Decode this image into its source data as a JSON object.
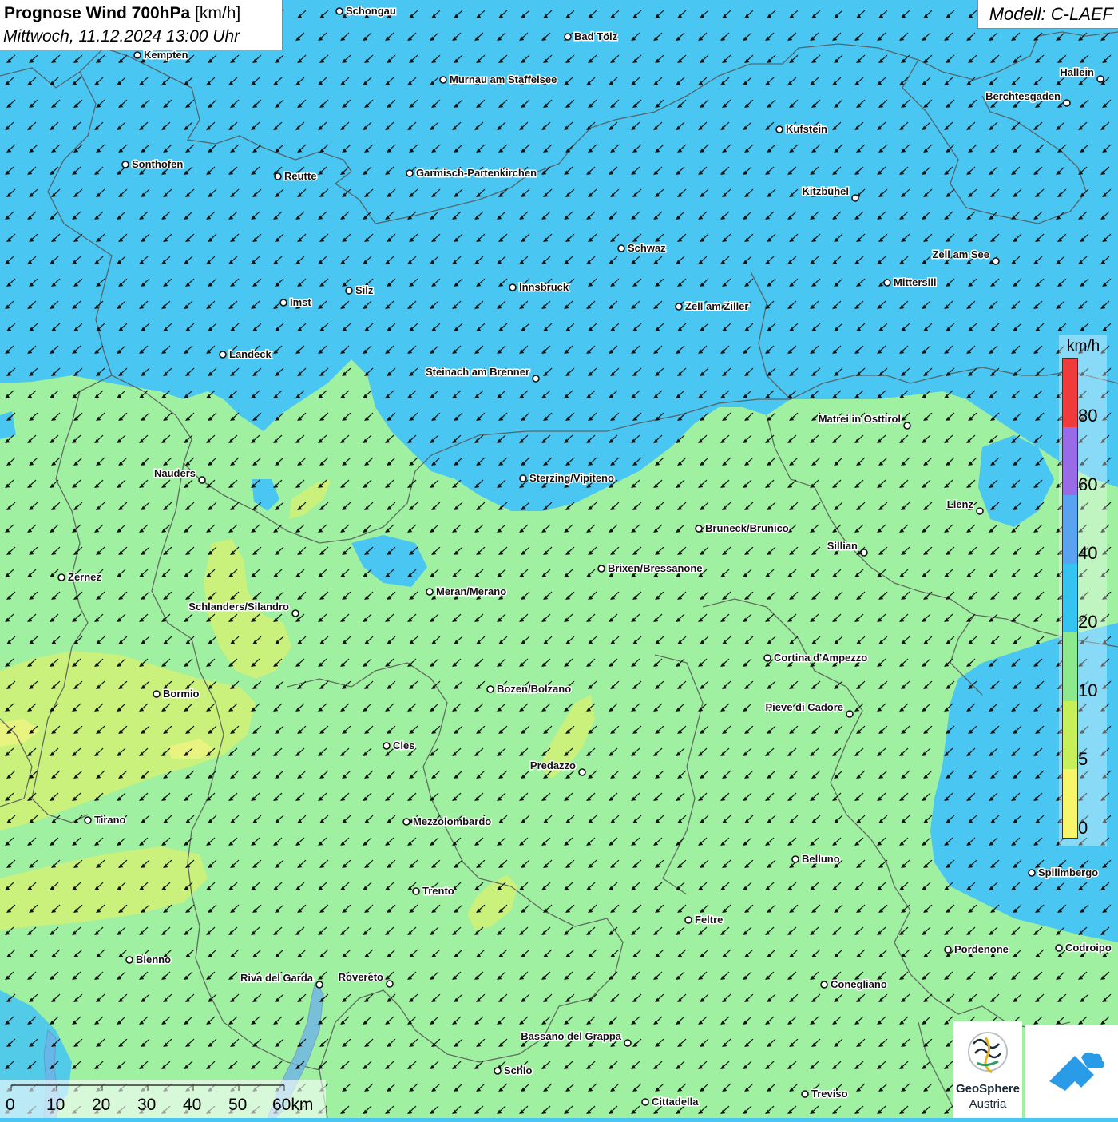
{
  "header": {
    "title_bold": "Prognose Wind 700hPa",
    "title_unit": "[km/h]",
    "datetime": "Mittwoch, 11.12.2024 13:00 Uhr",
    "model": "Modell: C-LAEF"
  },
  "legend": {
    "unit": "km/h",
    "ticks": [
      "80",
      "60",
      "40",
      "20",
      "10",
      "5",
      "0"
    ],
    "colors": [
      "#ef3b3b",
      "#9a6be8",
      "#5aa2f2",
      "#35c4f2",
      "#8de98d",
      "#c6ef5a",
      "#f7f56a"
    ]
  },
  "map_colors": {
    "wind_20_40": "#49c6f1",
    "wind_10_20": "#9ff0a1",
    "wind_5_10": "#c9f17c",
    "wind_0_5": "#ecf380",
    "borders": "#555555"
  },
  "wind": {
    "direction": "north-east wind (arrows point to south-west)"
  },
  "cities": [
    {
      "name": "Schongau"
    },
    {
      "name": "Bad Tölz"
    },
    {
      "name": "Kempten"
    },
    {
      "name": "Murnau am Staffelsee"
    },
    {
      "name": "Hallein"
    },
    {
      "name": "Berchtesgaden"
    },
    {
      "name": "Kufstein"
    },
    {
      "name": "Sonthofen"
    },
    {
      "name": "Reutte"
    },
    {
      "name": "Garmisch-Partenkirchen"
    },
    {
      "name": "Kitzbühel"
    },
    {
      "name": "Schwaz"
    },
    {
      "name": "Zell am See"
    },
    {
      "name": "Mittersill"
    },
    {
      "name": "Imst"
    },
    {
      "name": "Silz"
    },
    {
      "name": "Innsbruck"
    },
    {
      "name": "Zell am Ziller"
    },
    {
      "name": "Landeck"
    },
    {
      "name": "Steinach am Brenner"
    },
    {
      "name": "Matrei in Osttirol"
    },
    {
      "name": "Nauders"
    },
    {
      "name": "Sterzing/Vipiteno"
    },
    {
      "name": "Lienz"
    },
    {
      "name": "Bruneck/Brunico"
    },
    {
      "name": "Sillian"
    },
    {
      "name": "Brixen/Bressanone"
    },
    {
      "name": "Zernez"
    },
    {
      "name": "Meran/Merano"
    },
    {
      "name": "Schlanders/Silandro"
    },
    {
      "name": "Cortina d'Ampezzo"
    },
    {
      "name": "Bozen/Bolzano"
    },
    {
      "name": "Bormio"
    },
    {
      "name": "Pieve di Cadore"
    },
    {
      "name": "Cles"
    },
    {
      "name": "Predazzo"
    },
    {
      "name": "Tirano"
    },
    {
      "name": "Mezzolombardo"
    },
    {
      "name": "Belluno"
    },
    {
      "name": "Spilimbergo"
    },
    {
      "name": "Trento"
    },
    {
      "name": "Feltre"
    },
    {
      "name": "Pordenone"
    },
    {
      "name": "Codroipo"
    },
    {
      "name": "Bienno"
    },
    {
      "name": "Riva del Garda"
    },
    {
      "name": "Rovereto"
    },
    {
      "name": "Conegliano"
    },
    {
      "name": "Bassano del Grappa"
    },
    {
      "name": "Schio"
    },
    {
      "name": "Treviso"
    },
    {
      "name": "Cittadella"
    }
  ],
  "scale_bar": {
    "labels": [
      "0",
      "10",
      "20",
      "30",
      "40",
      "50",
      "60km"
    ]
  },
  "logos": {
    "geosphere_line1": "GeoSphere",
    "geosphere_line2": "Austria"
  }
}
